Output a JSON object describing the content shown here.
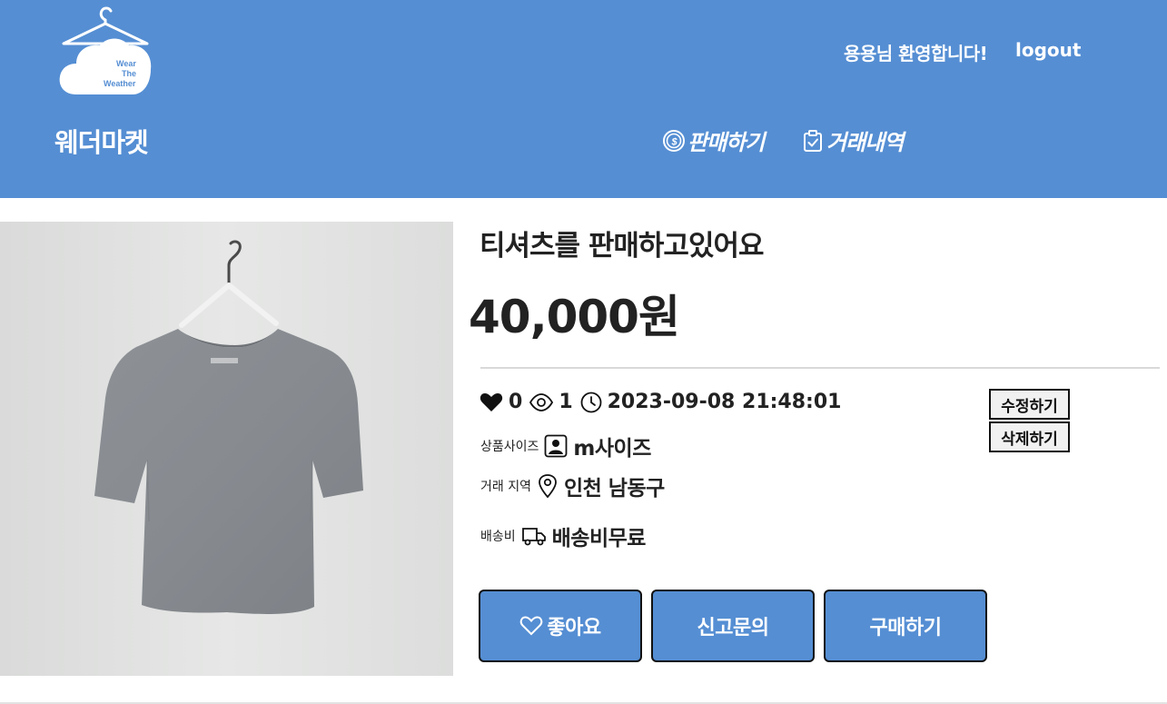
{
  "header": {
    "logo_text": "Wear The Weather",
    "brand": "웨더마켓",
    "welcome": "용용님 환영합니다!",
    "logout": "logout",
    "nav": {
      "sell": "판매하기",
      "history": "거래내역"
    },
    "bg_color": "#558ed3"
  },
  "product": {
    "title": "티셔츠를 판매하고있어요",
    "price": "40,000원",
    "likes": "0",
    "views": "1",
    "datetime": "2023-09-08 21:48:01",
    "size_label": "상품사이즈",
    "size_value": "m사이즈",
    "region_label": "거래 지역",
    "region_value": "인천 남동구",
    "shipping_label": "배송비",
    "shipping_value": "배송비무료"
  },
  "owner_actions": {
    "edit": "수정하기",
    "delete": "삭제하기"
  },
  "actions": {
    "like": "좋아요",
    "report": "신고문의",
    "buy": "구매하기"
  },
  "icons": [
    "hanger-cloud-logo",
    "coin-icon",
    "clipboard-icon",
    "heart-icon",
    "eye-icon",
    "clock-icon",
    "person-icon",
    "location-pin-icon",
    "truck-icon",
    "heart-outline-icon"
  ]
}
